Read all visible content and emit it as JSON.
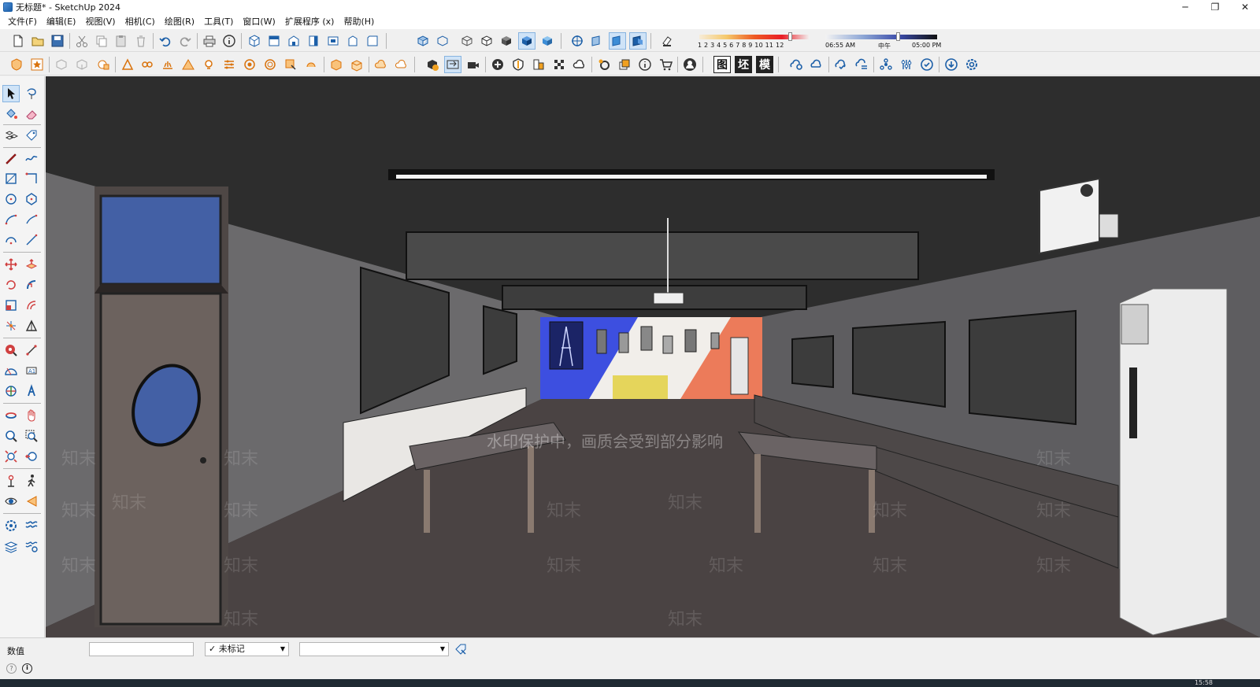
{
  "window": {
    "title": "无标题* - SketchUp 2024",
    "minimize": "─",
    "restore": "❐",
    "close": "✕"
  },
  "menu": [
    "文件(F)",
    "编辑(E)",
    "视图(V)",
    "相机(C)",
    "绘图(R)",
    "工具(T)",
    "窗口(W)",
    "扩展程序 (x)",
    "帮助(H)"
  ],
  "shadow": {
    "months": "1  2  3  4  5  6  7  8  9  10 11 12",
    "month_value": 0.82,
    "time_start": "06:55 AM",
    "time_mid": "中午",
    "time_end": "05:00 PM",
    "time_value": 0.65
  },
  "toolbar_right_labels": [
    "图",
    "坯",
    "模"
  ],
  "viewport": {
    "watermark": "水印保护中，画质会受到部分影响",
    "logo_text": "知末"
  },
  "status": {
    "measurements_label": "数值",
    "measurements_value": "",
    "tag_value": "未标记",
    "style_value": ""
  },
  "clock": "15:58",
  "colors": {
    "accent": "#1c5fa8",
    "toolbar_bg": "#f0f0f0",
    "toggle_on": "#cfe3f7"
  }
}
